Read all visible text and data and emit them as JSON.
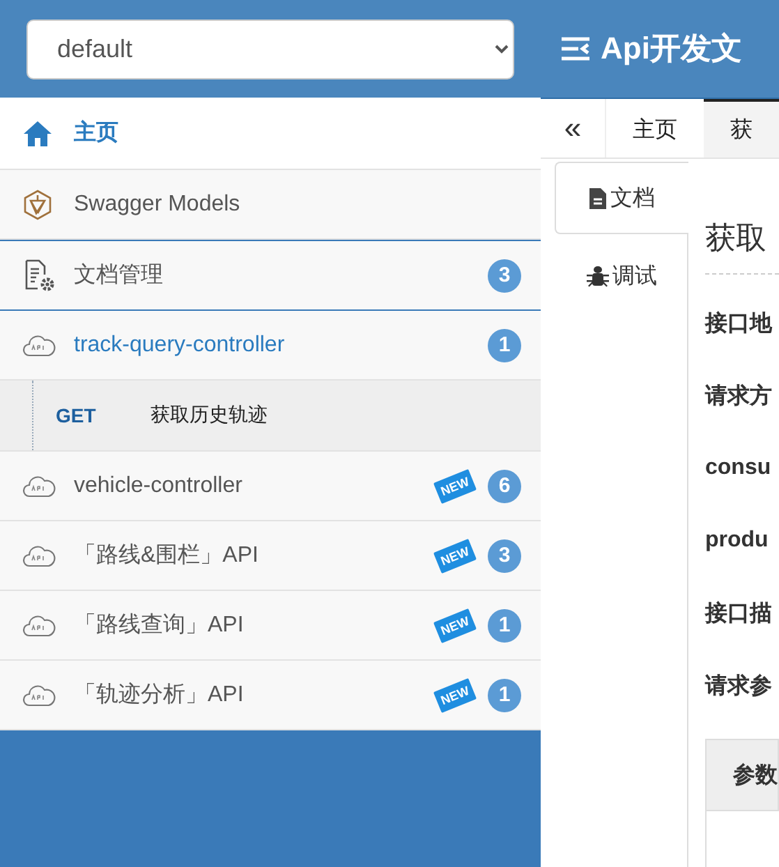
{
  "header": {
    "group_select": {
      "value": "default"
    },
    "title": "Api开发文"
  },
  "sidebar": {
    "items": [
      {
        "kind": "home",
        "label": "主页",
        "selected": true
      },
      {
        "kind": "models",
        "label": "Swagger Models",
        "selected": false
      },
      {
        "kind": "docs",
        "label": "文档管理",
        "count": "3",
        "selected": false
      },
      {
        "kind": "api",
        "label": "track-query-controller",
        "count": "1",
        "expanded": true,
        "selected": false,
        "children": [
          {
            "method": "GET",
            "label": "获取历史轨迹",
            "selected": false
          }
        ]
      },
      {
        "kind": "api",
        "label": "vehicle-controller",
        "count": "6",
        "new_badge": "NEW",
        "expanded": false,
        "selected": false
      },
      {
        "kind": "api",
        "label": "「路线&围栏」API",
        "count": "3",
        "new_badge": "NEW",
        "expanded": false,
        "selected": false
      },
      {
        "kind": "api",
        "label": "「路线查询」API",
        "count": "1",
        "new_badge": "NEW",
        "expanded": false,
        "selected": false
      },
      {
        "kind": "api",
        "label": "「轨迹分析」API",
        "count": "1",
        "new_badge": "NEW",
        "expanded": false,
        "selected": false
      }
    ]
  },
  "tab_bar": {
    "collapse_button": "«",
    "tabs": [
      {
        "label": "主页",
        "selected": false
      },
      {
        "label": "获",
        "selected": true
      }
    ]
  },
  "doc_tabs": [
    {
      "kind": "document",
      "label": "文档",
      "selected": true
    },
    {
      "kind": "debug",
      "label": "调试",
      "selected": false
    }
  ],
  "content": {
    "heading": "获取",
    "fields": [
      "接口地",
      "请求方",
      "consu",
      "produ",
      "接口描",
      "请求参"
    ],
    "table": {
      "columns": [
        "参数"
      ]
    }
  }
}
